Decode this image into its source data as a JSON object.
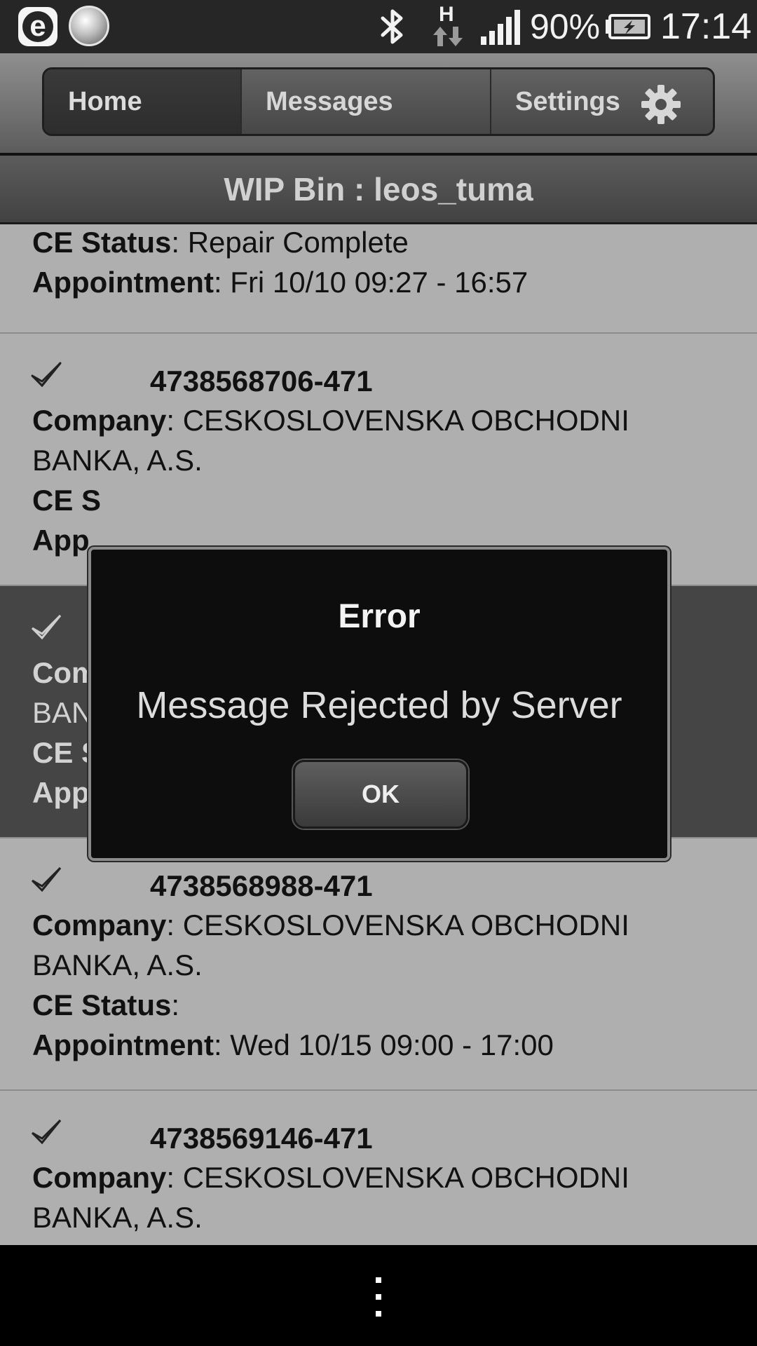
{
  "status_bar": {
    "left_icons": [
      "e-app-icon",
      "ball-app-icon"
    ],
    "right_icons": [
      "bluetooth-icon",
      "h-network-icon",
      "signal-icon",
      "battery-charging-icon"
    ],
    "network_type": "H",
    "battery_percent": "90%",
    "time": "17:14"
  },
  "tabs": [
    {
      "label": "Home"
    },
    {
      "label": "Messages"
    },
    {
      "label": "Settings",
      "icon": "gear-icon"
    }
  ],
  "title": "WIP Bin : leos_tuma",
  "labels": {
    "company": "Company",
    "ce_status": "CE Status",
    "appointment": "Appointment"
  },
  "items": [
    {
      "ce_status": "  Repair Complete",
      "appointment": ": Fri 10/10 09:27 -  16:57"
    },
    {
      "id": "4738568706-471",
      "company": ": CESKOSLOVENSKA OBCHODNI",
      "company_line2": "BANKA, A.S.",
      "ce_status_partial": "CE S",
      "appointment_partial": "App"
    },
    {
      "company_partial": "Com",
      "company_line2_partial": "BAN",
      "ce_status_partial": "CE S",
      "appointment_partial": "App",
      "selected": true
    },
    {
      "id": "4738568988-471",
      "company": ": CESKOSLOVENSKA OBCHODNI",
      "company_line2": "BANKA, A.S.",
      "ce_status": ":",
      "appointment": ": Wed 10/15 09:00 -  17:00"
    },
    {
      "id": "4738569146-471",
      "company": ": CESKOSLOVENSKA OBCHODNI",
      "company_line2": "BANKA, A.S."
    }
  ],
  "dialog": {
    "title": "Error",
    "message": "Message Rejected by Server",
    "ok_label": "OK"
  },
  "nav_bar": {
    "icon": "overflow-menu-icon"
  }
}
